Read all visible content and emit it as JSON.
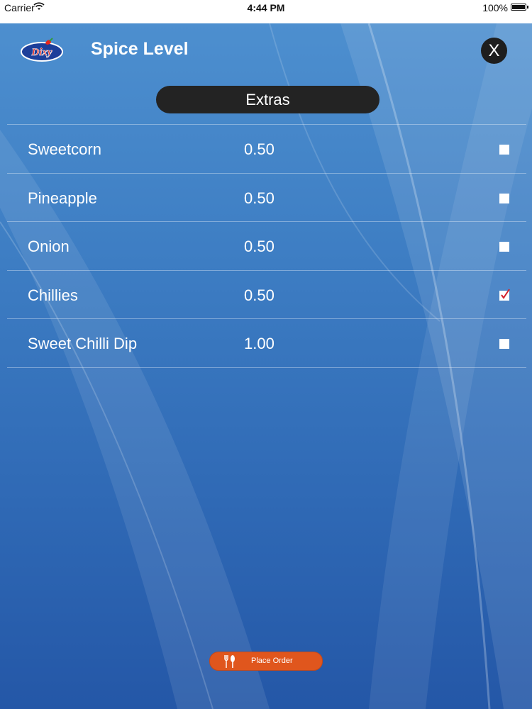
{
  "status_bar": {
    "carrier": "Carrier",
    "time": "4:44 PM",
    "battery": "100%"
  },
  "header": {
    "logo_text": "Dixy",
    "title": "Spice Level",
    "close_label": "X"
  },
  "section": {
    "title": "Extras"
  },
  "extras": [
    {
      "name": "Sweetcorn",
      "price": "0.50",
      "checked": false
    },
    {
      "name": "Pineapple",
      "price": "0.50",
      "checked": false
    },
    {
      "name": "Onion",
      "price": "0.50",
      "checked": false
    },
    {
      "name": "Chillies",
      "price": "0.50",
      "checked": true
    },
    {
      "name": "Sweet Chilli Dip",
      "price": "1.00",
      "checked": false
    }
  ],
  "footer": {
    "place_order_label": "Place Order"
  },
  "colors": {
    "accent": "#e0561d",
    "check": "#d3202a"
  },
  "icons": [
    "wifi-icon",
    "battery-icon",
    "close-icon",
    "checkbox-icon",
    "check-mark-icon",
    "cutlery-icon"
  ]
}
